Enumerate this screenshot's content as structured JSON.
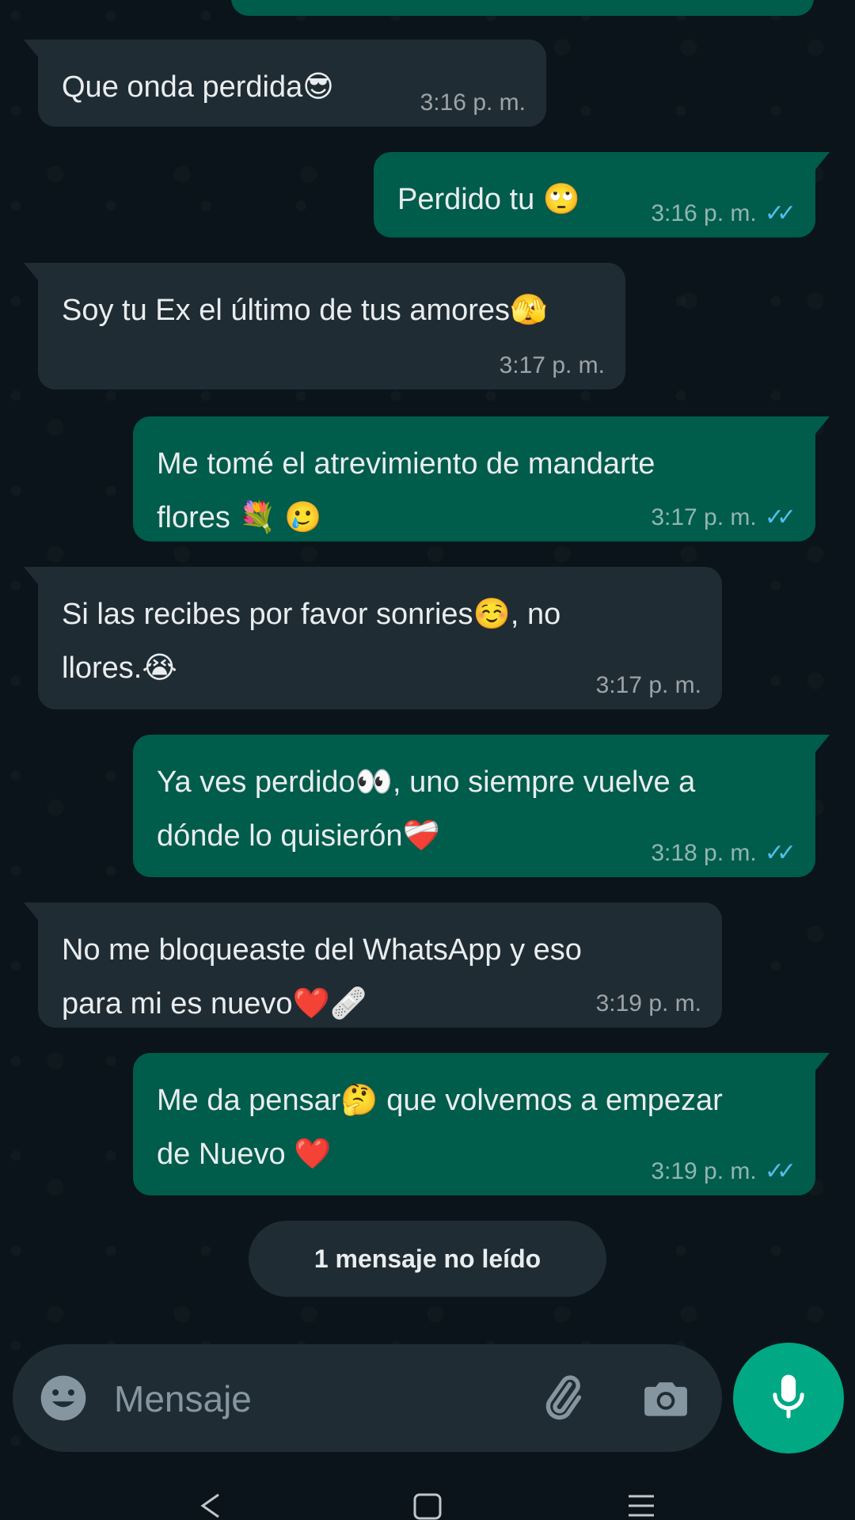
{
  "messages": [
    {
      "dir": "in",
      "text": "Que onda perdida😎",
      "time": "3:16 p. m."
    },
    {
      "dir": "out",
      "text": "Perdido tu 🙄",
      "time": "3:16 p. m."
    },
    {
      "dir": "in",
      "text": "Soy tu Ex el último de tus amores🫣",
      "time": "3:17 p. m."
    },
    {
      "dir": "out",
      "text": "Me tomé el atrevimiento de mandarte\nflores 💐 🥲",
      "time": "3:17 p. m."
    },
    {
      "dir": "in",
      "text": "Si las recibes por favor sonries☺️, no\nllores.😭",
      "time": "3:17 p. m."
    },
    {
      "dir": "out",
      "text": "Ya ves perdido👀, uno siempre vuelve a\ndónde lo quisierón❤️‍🩹",
      "time": "3:18 p. m."
    },
    {
      "dir": "in",
      "text": "No me bloqueaste del WhatsApp y eso\npara mi es nuevo❤️🩹",
      "time": "3:19 p. m."
    },
    {
      "dir": "out",
      "text": "Me da pensar🤔 que volvemos a empezar\nde Nuevo ❤️",
      "time": "3:19 p. m."
    }
  ],
  "unread_label": "1 mensaje no leído",
  "composer": {
    "placeholder": "Mensaje",
    "emoji_icon": "emoji-icon",
    "attach_icon": "paperclip-icon",
    "camera_icon": "camera-icon",
    "mic_icon": "microphone-icon"
  },
  "colors": {
    "background": "#0b141a",
    "incoming_bubble": "#202c33",
    "outgoing_bubble": "#005c4b",
    "read_ticks": "#53bdeb",
    "mic_button": "#00a884"
  }
}
